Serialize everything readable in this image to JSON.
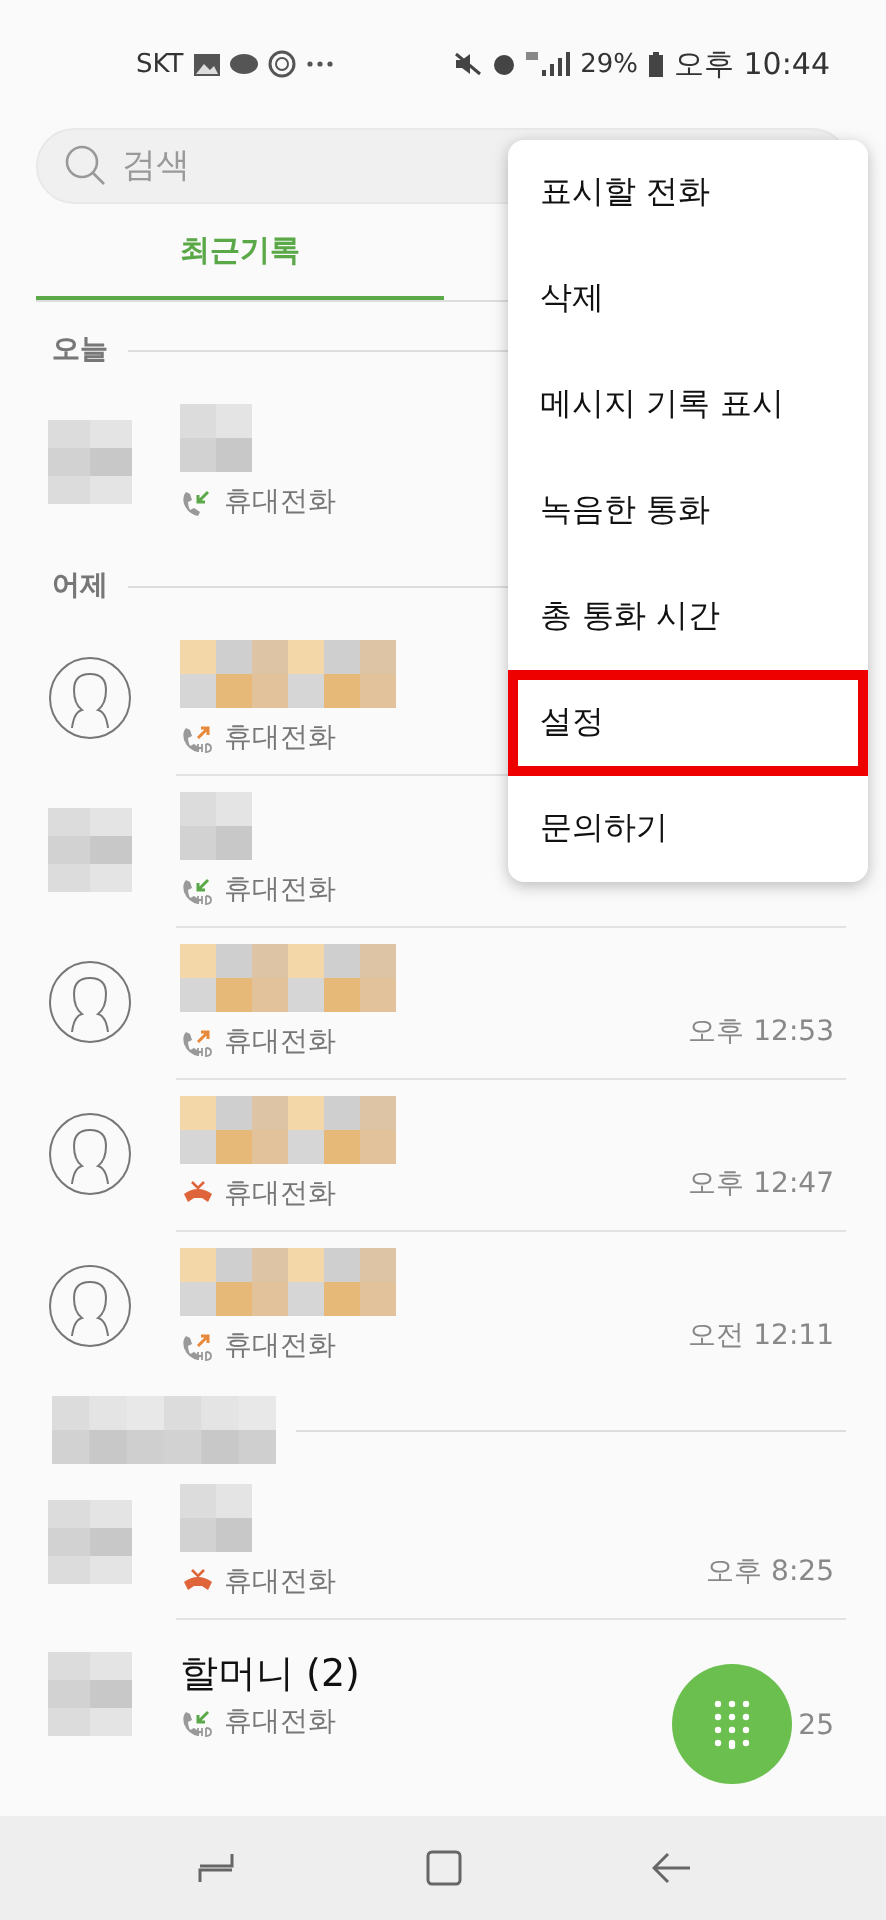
{
  "status_bar": {
    "carrier": "SKT",
    "battery": "29%",
    "time": "오후 10:44"
  },
  "search": {
    "placeholder": "검색"
  },
  "tabs": [
    {
      "label": "최근기록",
      "selected": true
    }
  ],
  "sections": [
    {
      "label": "오늘",
      "blurred": false,
      "calls": [
        {
          "kind": "incoming",
          "avatar_blurred": true,
          "name_blurred": true,
          "name_tinted": false,
          "hd": false,
          "type": "휴대전화"
        }
      ]
    },
    {
      "label": "어제",
      "blurred": false,
      "calls": [
        {
          "kind": "outgoing",
          "avatar_blurred": false,
          "name_blurred": true,
          "name_tinted": true,
          "hd": true,
          "type": "휴대전화"
        },
        {
          "kind": "incoming",
          "avatar_blurred": true,
          "name_blurred": true,
          "name_tinted": false,
          "hd": true,
          "type": "휴대전화"
        },
        {
          "kind": "outgoing",
          "avatar_blurred": false,
          "name_blurred": true,
          "name_tinted": true,
          "hd": true,
          "type": "휴대전화",
          "time": "오후 12:53"
        },
        {
          "kind": "missed",
          "avatar_blurred": false,
          "name_blurred": true,
          "name_tinted": true,
          "hd": false,
          "type": "휴대전화",
          "time": "오후 12:47"
        },
        {
          "kind": "outgoing",
          "avatar_blurred": false,
          "name_blurred": true,
          "name_tinted": true,
          "hd": true,
          "type": "휴대전화",
          "time": "오전 12:11"
        }
      ]
    },
    {
      "blurred": true,
      "calls": [
        {
          "kind": "missed",
          "avatar_blurred": true,
          "name_blurred": true,
          "name_tinted": false,
          "hd": false,
          "type": "휴대전화",
          "time": "오후 8:25"
        },
        {
          "kind": "incoming",
          "avatar_blurred": true,
          "name_blurred": false,
          "name": "할머니 (2)",
          "hd": true,
          "type": "휴대전화",
          "time": "25"
        }
      ]
    }
  ],
  "menu": [
    {
      "label": "표시할 전화",
      "highlighted": false
    },
    {
      "label": "삭제",
      "highlighted": false
    },
    {
      "label": "메시지 기록 표시",
      "highlighted": false
    },
    {
      "label": "녹음한 통화",
      "highlighted": false
    },
    {
      "label": "총 통화 시간",
      "highlighted": false
    },
    {
      "label": "설정",
      "highlighted": true
    },
    {
      "label": "문의하기",
      "highlighted": false
    }
  ]
}
